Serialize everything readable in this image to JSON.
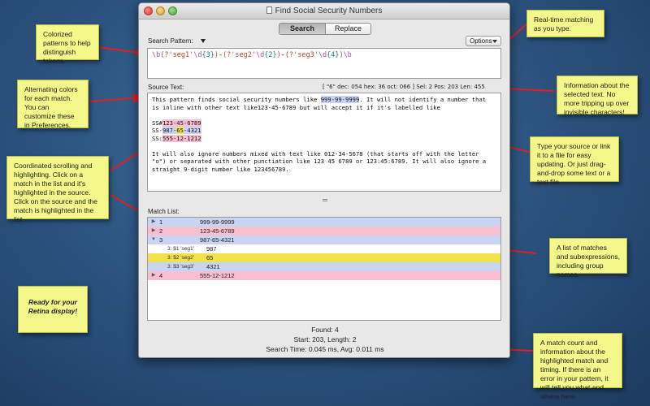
{
  "window": {
    "title": "Find Social Security Numbers"
  },
  "tabs": {
    "search": "Search",
    "replace": "Replace"
  },
  "search_pattern": {
    "label": "Search Pattern:",
    "options_label": "Options",
    "tokens": [
      {
        "text": "\\b",
        "color": "#b54bb0"
      },
      {
        "text": "(?'seg1'",
        "color": "#c24a2a"
      },
      {
        "text": "\\d",
        "color": "#b54bb0"
      },
      {
        "text": "{3}",
        "color": "#1b7f86"
      },
      {
        "text": ")",
        "color": "#c24a2a"
      },
      {
        "text": "-",
        "color": "#222222"
      },
      {
        "text": "(?'seg2'",
        "color": "#c24a2a"
      },
      {
        "text": "\\d",
        "color": "#b54bb0"
      },
      {
        "text": "{2}",
        "color": "#1b7f86"
      },
      {
        "text": ")",
        "color": "#c24a2a"
      },
      {
        "text": "-",
        "color": "#222222"
      },
      {
        "text": "(?'seg3'",
        "color": "#c24a2a"
      },
      {
        "text": "\\d",
        "color": "#b54bb0"
      },
      {
        "text": "{4}",
        "color": "#1b7f86"
      },
      {
        "text": ")",
        "color": "#c24a2a"
      },
      {
        "text": "\\b",
        "color": "#b54bb0"
      }
    ]
  },
  "source": {
    "label": "Source Text:",
    "info": "[ \"6\" dec: 054 hex: 36 oct: 066 ] Sel: 2 Pos: 203 Len: 455",
    "line1_pre": "This pattern finds social security numbers like ",
    "line1_match": "999-99-9999",
    "line1_post": ". It will not identify a number that",
    "line2": "is inline with other text like123-45-6789 but will accept it if it's labelled like",
    "line3_pre": "SS#",
    "line3_match": "123-45-6789",
    "line4_pre": "SS-",
    "line4_m1": "987-",
    "line4_m2": "65",
    "line4_m3": "-4321",
    "line5_pre": "SS:",
    "line5_match": "555-12-1212",
    "line6": "It will also ignore numbers mixed with text like 012-34-5678 (that starts off with the letter",
    "line7": "\"o\") or separated with other punctiation like 123 45 6789 or 123:45:6789. It will also ignore a",
    "line8": "straight 9-digit number like 123456789."
  },
  "match_list": {
    "label": "Match List:",
    "rows": [
      {
        "tri": "▶",
        "num": "1",
        "value": "999-99-9999",
        "style": "r-blue",
        "sub": false
      },
      {
        "tri": "▶",
        "num": "2",
        "value": "123-45-6789",
        "style": "r-pink",
        "sub": false
      },
      {
        "tri": "▼",
        "num": "3",
        "value": "987-65-4321",
        "style": "r-blue",
        "sub": false
      },
      {
        "tri": "",
        "num": "3: $1 'seg1'",
        "value": "987",
        "style": "r-white",
        "sub": true
      },
      {
        "tri": "",
        "num": "3: $2 'seg2'",
        "value": "65",
        "style": "r-yellow",
        "sub": true
      },
      {
        "tri": "",
        "num": "3: $3 'seg3'",
        "value": "4321",
        "style": "r-blue",
        "sub": true
      },
      {
        "tri": "▶",
        "num": "4",
        "value": "555-12-1212",
        "style": "r-pink",
        "sub": false
      }
    ]
  },
  "status": {
    "found": "Found: 4",
    "start": "Start: 203, Length: 2",
    "timing": "Search Time: 0.045 ms, Avg: 0.011 ms"
  },
  "notes": {
    "colorized": "Colorized patterns to help distinguish tokens.",
    "alternating": "Alternating colors for each match. You can customize these in Preferences.",
    "coordinated": "Coordinated scrolling and highlighting. Click on a match in the list and it's highlighted in the source. Click on the source and the match is highlighted in the list.",
    "retina": "Ready for your Retina display!",
    "realtime": "Real-time matching as you type.",
    "information": "Information about the selected text. No more tripping up over invisible characters!",
    "type_source": "Type your source or link it to a file for easy updating. Or just drag-and-drop some text or a text file.",
    "list_matches": "A list of matches and subexpressions, including group names.",
    "match_count": "A match count and information about the highlighted match and timing. If there is an error in your pattern, it will tell you what and where here."
  }
}
